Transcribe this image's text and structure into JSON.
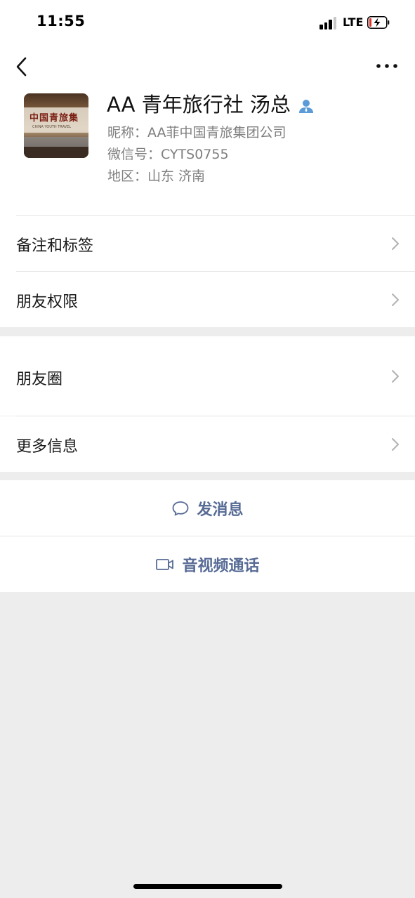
{
  "status_bar": {
    "time": "11:55",
    "network": "LTE"
  },
  "profile": {
    "name": "AA 青年旅行社 汤总",
    "nickname": "昵称：AA菲中国青旅集团公司",
    "wechat_id": "微信号：CYTS0755",
    "region": "地区：山东 济南",
    "avatar_caption": "中国青旅集",
    "avatar_subcaption": "CHINA YOUTH TRAVEL"
  },
  "menu": {
    "remarks_tags": "备注和标签",
    "friend_permissions": "朋友权限",
    "moments": "朋友圈",
    "more_info": "更多信息"
  },
  "actions": {
    "send_message": "发消息",
    "video_call": "音视频通话"
  },
  "colors": {
    "link_blue": "#576b95",
    "background": "#ededed"
  }
}
